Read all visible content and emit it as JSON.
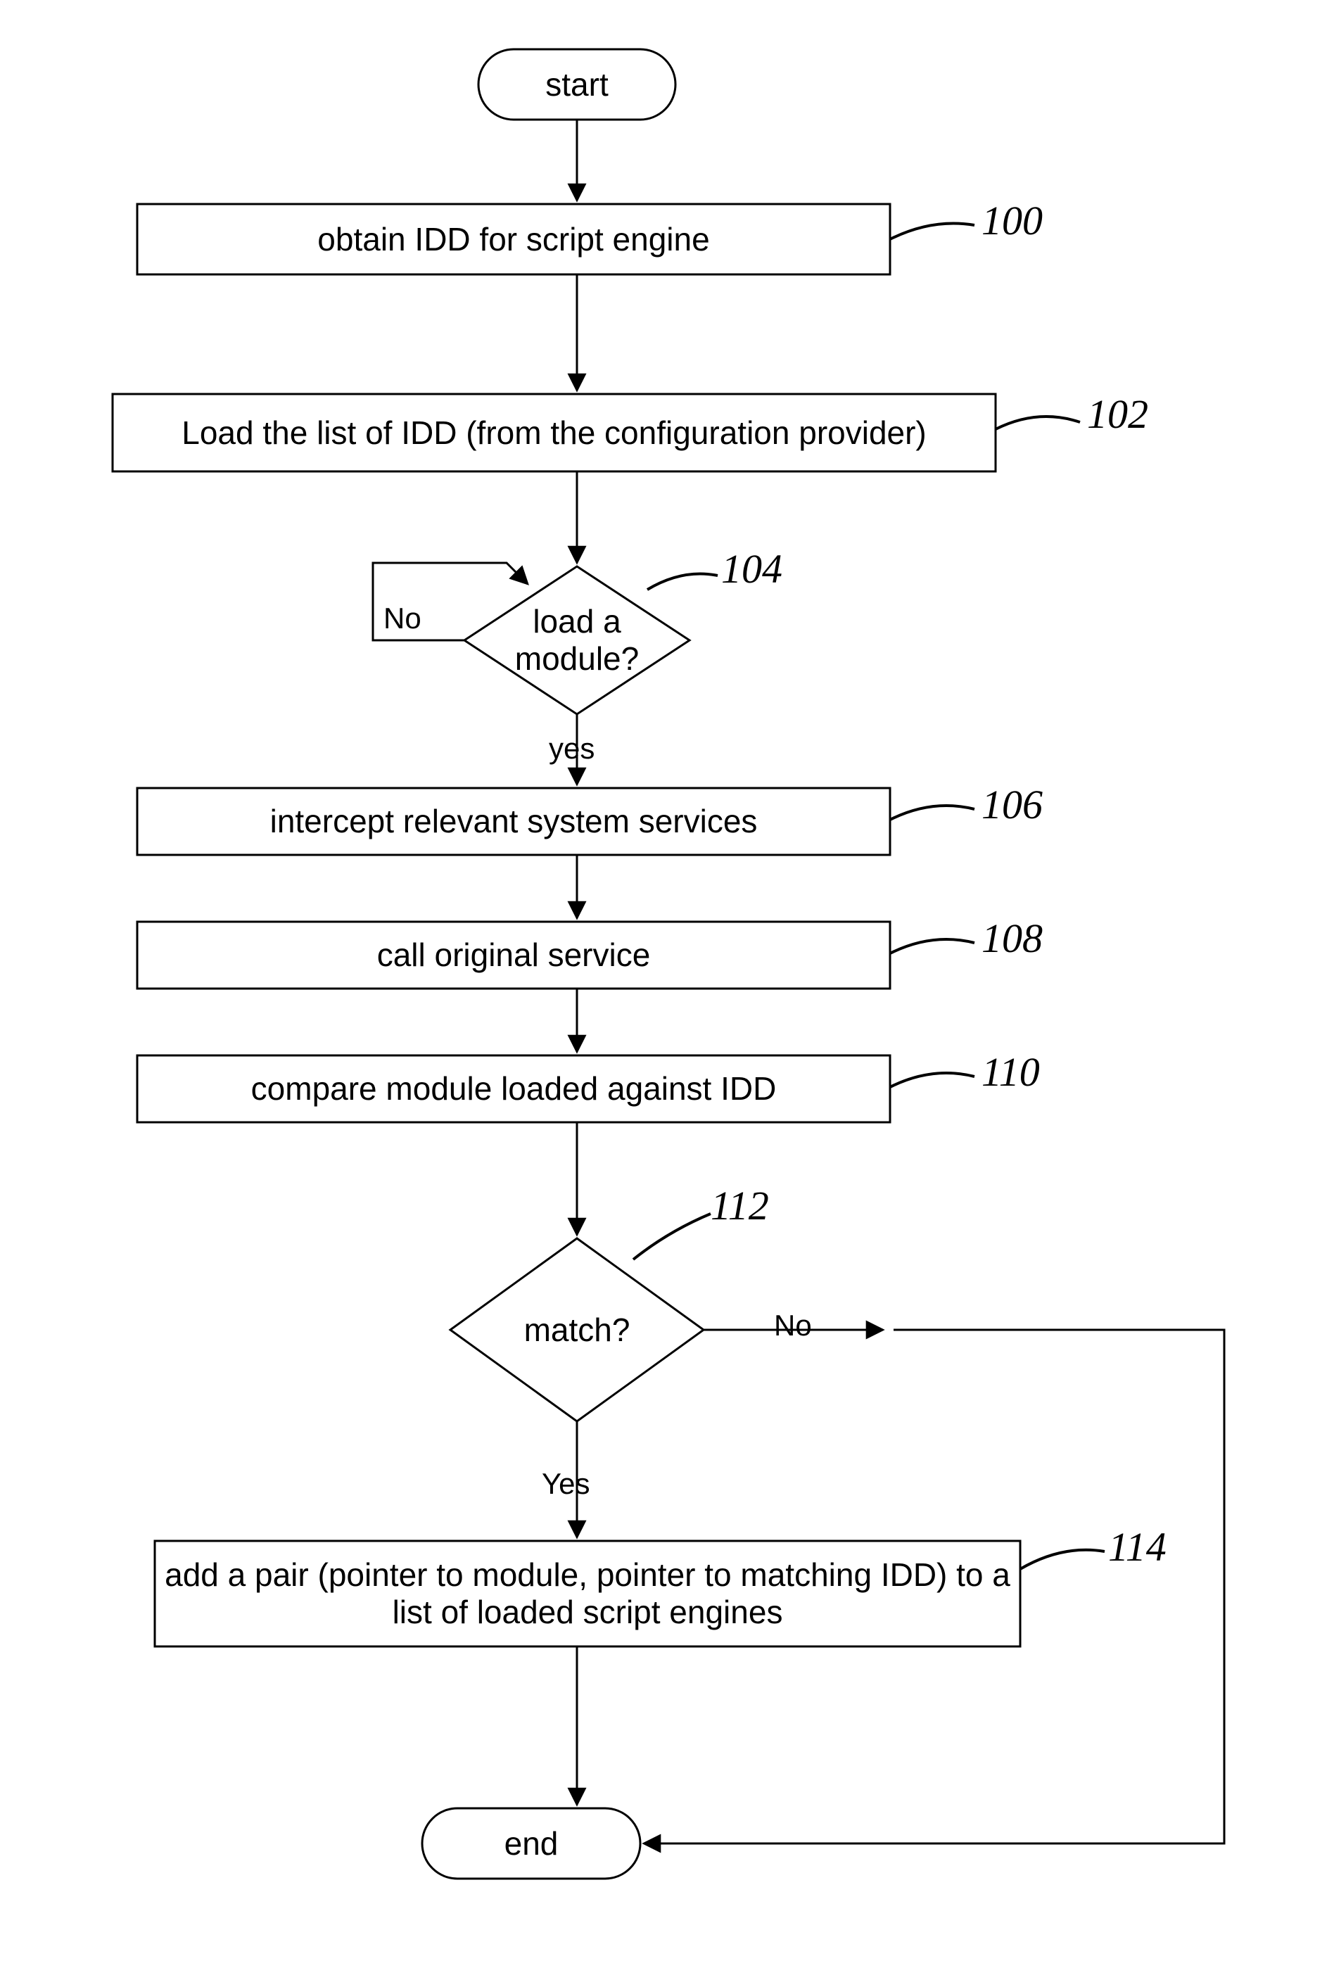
{
  "nodes": {
    "start": "start",
    "step100": "obtain IDD for script engine",
    "step102": "Load the list of IDD (from the configuration provider)",
    "step104": "load a module?",
    "step106": "intercept relevant system services",
    "step108": "call original service",
    "step110": "compare module loaded against IDD",
    "step112": "match?",
    "step114": "add a pair (pointer to module, pointer to matching IDD) to a list of loaded script engines",
    "end": "end"
  },
  "labels": {
    "ref100": "100",
    "ref102": "102",
    "ref104": "104",
    "ref106": "106",
    "ref108": "108",
    "ref110": "110",
    "ref112": "112",
    "ref114": "114"
  },
  "edge_labels": {
    "no104": "No",
    "yes104": "yes",
    "no112": "No",
    "yes112": "Yes"
  },
  "chart_data": {
    "type": "flowchart",
    "nodes": [
      {
        "id": "start",
        "type": "terminator",
        "text": "start"
      },
      {
        "id": "100",
        "type": "process",
        "text": "obtain IDD for script engine",
        "ref": "100"
      },
      {
        "id": "102",
        "type": "process",
        "text": "Load the list of IDD (from the configuration provider)",
        "ref": "102"
      },
      {
        "id": "104",
        "type": "decision",
        "text": "load a module?",
        "ref": "104"
      },
      {
        "id": "106",
        "type": "process",
        "text": "intercept relevant system services",
        "ref": "106"
      },
      {
        "id": "108",
        "type": "process",
        "text": "call original service",
        "ref": "108"
      },
      {
        "id": "110",
        "type": "process",
        "text": "compare module loaded against IDD",
        "ref": "110"
      },
      {
        "id": "112",
        "type": "decision",
        "text": "match?",
        "ref": "112"
      },
      {
        "id": "114",
        "type": "process",
        "text": "add a pair (pointer to module, pointer to matching IDD) to a list of loaded script engines",
        "ref": "114"
      },
      {
        "id": "end",
        "type": "terminator",
        "text": "end"
      }
    ],
    "edges": [
      {
        "from": "start",
        "to": "100"
      },
      {
        "from": "100",
        "to": "102"
      },
      {
        "from": "102",
        "to": "104"
      },
      {
        "from": "104",
        "to": "104",
        "label": "No",
        "loop": true
      },
      {
        "from": "104",
        "to": "106",
        "label": "yes"
      },
      {
        "from": "106",
        "to": "108"
      },
      {
        "from": "108",
        "to": "110"
      },
      {
        "from": "110",
        "to": "112"
      },
      {
        "from": "112",
        "to": "114",
        "label": "Yes"
      },
      {
        "from": "112",
        "to": "end",
        "label": "No"
      },
      {
        "from": "114",
        "to": "end"
      }
    ]
  }
}
